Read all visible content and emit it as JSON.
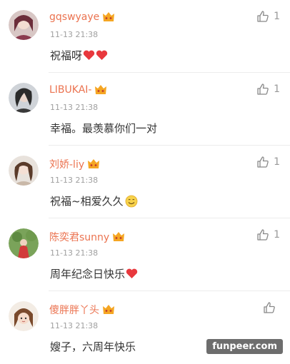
{
  "comments": [
    {
      "username": "gqswyaye",
      "time": "11-13 21:38",
      "text": "祝福呀",
      "likes": "1"
    },
    {
      "username": "LIBUKAI-",
      "time": "11-13 21:38",
      "text": "幸福。最羡慕你们一对",
      "likes": "1"
    },
    {
      "username": "刘娇-liy",
      "time": "11-13 21:38",
      "text": "祝福~相爱久久",
      "likes": "1"
    },
    {
      "username": "陈奕君sunny",
      "time": "11-13 21:38",
      "text": "周年纪念日快乐",
      "likes": "1"
    },
    {
      "username": "傻胖胖丫头",
      "time": "11-13 21:38",
      "text": "嫂子，六周年快乐",
      "likes": ""
    }
  ],
  "watermark": "funpeer.com",
  "colors": {
    "username": "#eb7350",
    "badge": "#f5a623",
    "heart": "#e8383d"
  }
}
